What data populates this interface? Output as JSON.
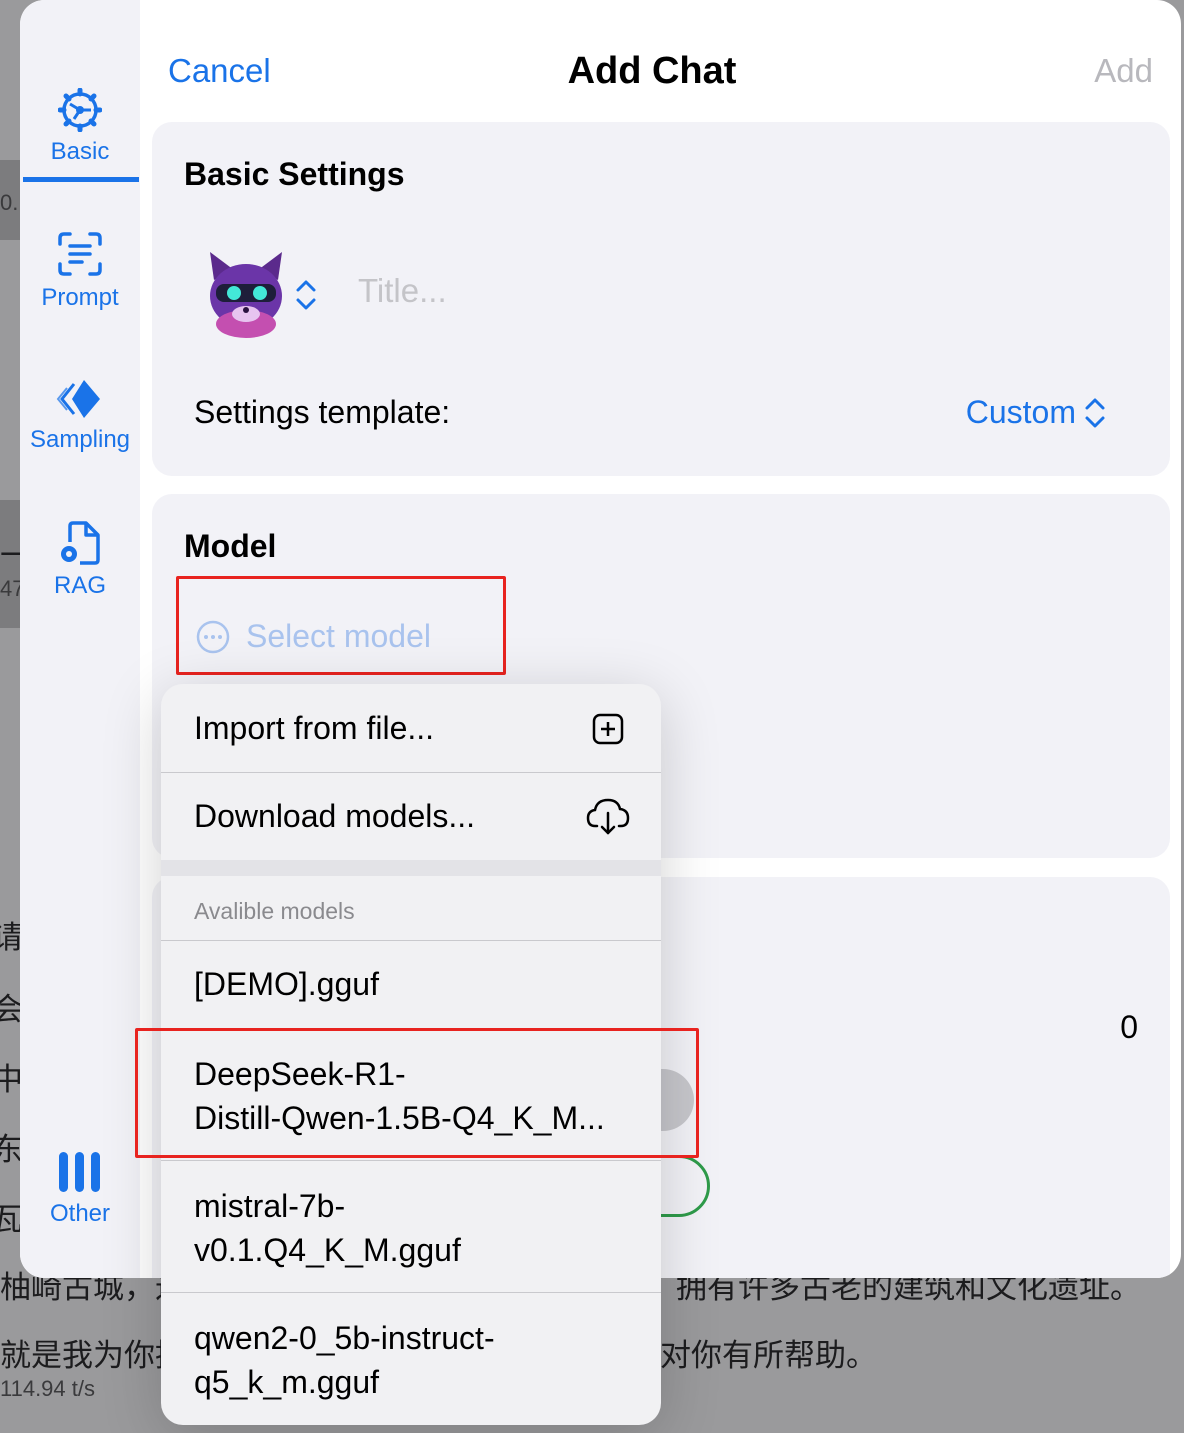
{
  "background": {
    "lines": [
      "请仍",
      "会睡",
      "中安",
      "东京",
      "瓦也",
      "柚崎古城，这",
      "拥有许多古老的建筑和文化遗址。",
      "就是我为你推",
      "对你有所帮助。"
    ],
    "stats": [
      "0.",
      "一台",
      "47",
      "114.94 t/s"
    ]
  },
  "header": {
    "cancel": "Cancel",
    "title": "Add Chat",
    "add": "Add"
  },
  "tabs": [
    {
      "label": "Basic",
      "icon": "gear-icon",
      "selected": true
    },
    {
      "label": "Prompt",
      "icon": "document-scan-icon"
    },
    {
      "label": "Sampling",
      "icon": "diamond-motion-icon"
    },
    {
      "label": "RAG",
      "icon": "document-gear-icon"
    },
    {
      "label": "Other",
      "icon": "three-bars-icon"
    }
  ],
  "basic_settings": {
    "title": "Basic Settings",
    "avatar": "cat-robot-avatar",
    "title_placeholder": "Title...",
    "template_label": "Settings template:",
    "template_value": "Custom"
  },
  "model": {
    "title": "Model",
    "select_placeholder": "Select model"
  },
  "partial_card": {
    "value": "0"
  },
  "menu": {
    "actions": [
      {
        "label": "Import from file...",
        "icon": "plus-square-icon"
      },
      {
        "label": "Download models...",
        "icon": "cloud-download-icon"
      }
    ],
    "section_header": "Avalible models",
    "models": [
      {
        "line1": "[DEMO].gguf",
        "line2": ""
      },
      {
        "line1": "DeepSeek-R1-",
        "line2": "Distill-Qwen-1.5B-Q4_K_M..."
      },
      {
        "line1": "mistral-7b-",
        "line2": "v0.1.Q4_K_M.gguf"
      },
      {
        "line1": "qwen2-0_5b-instruct-",
        "line2": "q5_k_m.gguf"
      }
    ]
  },
  "colors": {
    "accent": "#1a73e8",
    "highlight": "#e8231f",
    "placeholder": "#c4c4c8"
  }
}
